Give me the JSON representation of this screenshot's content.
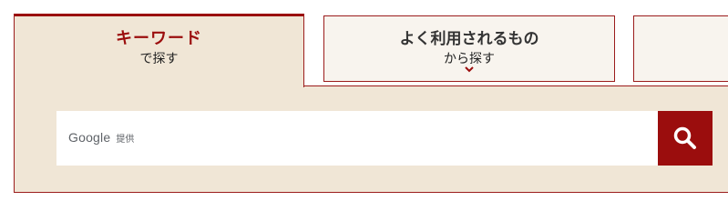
{
  "tabs": [
    {
      "title": "キーワード",
      "subtitle": "で探す",
      "active": true
    },
    {
      "title": "よく利用されるもの",
      "subtitle": "から探す",
      "active": false,
      "icon": "chevron-down-icon"
    },
    {
      "title": "",
      "subtitle": "",
      "active": false
    }
  ],
  "search": {
    "brand": "Google",
    "provided_by": "提供",
    "value": "",
    "button_icon": "search-icon"
  },
  "colors": {
    "accent": "#9b0d0d",
    "panel_bg": "#f0e6d6",
    "tab_bg": "#f8f4ee",
    "border": "#9b1c1c"
  }
}
